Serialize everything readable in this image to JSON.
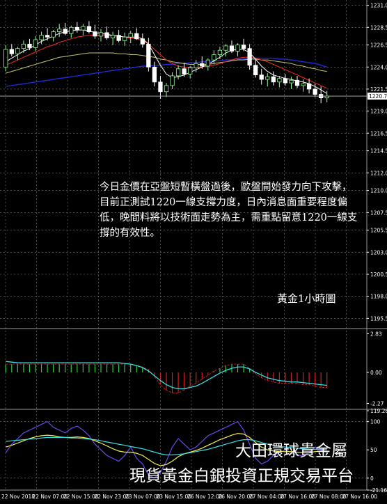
{
  "chart_data": {
    "type": "candlestick",
    "timeframe_label": "黃金1小時圖",
    "x_tick_labels": [
      "22 Nov 2018",
      "22 Nov 07:00",
      "22 Nov 15:00",
      "22 Nov 23:00",
      "23 Nov 07:00",
      "23 Nov 15:00",
      "26 Nov 12:00",
      "26 Nov 20:00",
      "27 Nov 04:00",
      "27 Nov 16:00",
      "27 Nov 08:00",
      "27 Nov 16:00"
    ],
    "price_panel": {
      "y_tick_labels": [
        "1231.0",
        "1228.5",
        "1226.5",
        "1224.0",
        "1221.5",
        "1219.0",
        "1216.5",
        "1214.5",
        "1212.0",
        "1210.0",
        "1207.5",
        "1205.5",
        "1203.0",
        "1200.5",
        "1198.0",
        "1195.5"
      ],
      "current_price": "1220.7",
      "ylim": [
        1194.5,
        1231.6
      ],
      "candles": [
        [
          1224.0,
          1226.5,
          1223.5,
          1226.0
        ],
        [
          1226.0,
          1226.6,
          1225.2,
          1225.5
        ],
        [
          1225.5,
          1226.3,
          1224.8,
          1226.1
        ],
        [
          1226.1,
          1227.0,
          1225.6,
          1226.6
        ],
        [
          1226.6,
          1227.2,
          1225.9,
          1226.2
        ],
        [
          1226.2,
          1227.5,
          1225.8,
          1227.1
        ],
        [
          1227.1,
          1228.0,
          1226.6,
          1227.6
        ],
        [
          1227.6,
          1228.4,
          1227.0,
          1227.4
        ],
        [
          1227.4,
          1228.2,
          1226.9,
          1228.0
        ],
        [
          1228.0,
          1228.9,
          1227.4,
          1228.3
        ],
        [
          1228.3,
          1229.0,
          1227.6,
          1227.8
        ],
        [
          1227.8,
          1228.7,
          1227.3,
          1228.5
        ],
        [
          1228.5,
          1229.1,
          1227.9,
          1228.2
        ],
        [
          1228.2,
          1228.9,
          1227.6,
          1228.6
        ],
        [
          1228.6,
          1229.2,
          1227.8,
          1228.0
        ],
        [
          1228.0,
          1228.8,
          1227.2,
          1227.5
        ],
        [
          1227.5,
          1228.3,
          1226.9,
          1227.9
        ],
        [
          1227.9,
          1228.6,
          1227.1,
          1227.3
        ],
        [
          1227.3,
          1228.0,
          1226.5,
          1227.6
        ],
        [
          1227.6,
          1228.2,
          1226.8,
          1227.0
        ],
        [
          1227.0,
          1227.9,
          1226.4,
          1227.4
        ],
        [
          1227.4,
          1228.1,
          1226.7,
          1227.8
        ],
        [
          1227.8,
          1228.4,
          1227.1,
          1227.2
        ],
        [
          1227.2,
          1227.8,
          1226.2,
          1226.6
        ],
        [
          1226.6,
          1227.3,
          1223.5,
          1224.0
        ],
        [
          1224.0,
          1224.6,
          1221.8,
          1222.3
        ],
        [
          1222.3,
          1223.0,
          1220.4,
          1221.2
        ],
        [
          1221.2,
          1222.2,
          1220.6,
          1221.9
        ],
        [
          1221.9,
          1223.4,
          1221.5,
          1223.0
        ],
        [
          1223.0,
          1224.2,
          1222.6,
          1223.8
        ],
        [
          1223.8,
          1224.5,
          1222.9,
          1223.2
        ],
        [
          1223.2,
          1224.1,
          1222.7,
          1223.9
        ],
        [
          1223.9,
          1224.8,
          1223.4,
          1224.4
        ],
        [
          1224.4,
          1225.2,
          1223.8,
          1224.1
        ],
        [
          1224.1,
          1225.0,
          1223.6,
          1224.8
        ],
        [
          1224.8,
          1225.9,
          1224.3,
          1225.4
        ],
        [
          1225.4,
          1226.3,
          1224.9,
          1225.9
        ],
        [
          1225.9,
          1226.6,
          1225.2,
          1226.4
        ],
        [
          1226.4,
          1227.0,
          1225.6,
          1225.8
        ],
        [
          1225.8,
          1226.7,
          1225.2,
          1226.5
        ],
        [
          1226.5,
          1227.2,
          1225.8,
          1226.1
        ],
        [
          1226.1,
          1226.6,
          1223.7,
          1224.2
        ],
        [
          1224.2,
          1224.9,
          1222.8,
          1223.1
        ],
        [
          1223.1,
          1223.8,
          1222.0,
          1222.6
        ],
        [
          1222.6,
          1223.3,
          1221.8,
          1222.9
        ],
        [
          1222.9,
          1223.5,
          1221.9,
          1222.3
        ],
        [
          1222.3,
          1223.0,
          1221.7,
          1222.7
        ],
        [
          1222.7,
          1223.2,
          1221.9,
          1222.2
        ],
        [
          1222.2,
          1222.9,
          1221.5,
          1222.5
        ],
        [
          1222.5,
          1223.0,
          1221.6,
          1221.9
        ],
        [
          1221.9,
          1222.6,
          1221.2,
          1222.1
        ],
        [
          1222.1,
          1222.7,
          1221.0,
          1221.5
        ],
        [
          1221.5,
          1222.1,
          1220.6,
          1220.9
        ],
        [
          1220.9,
          1221.8,
          1219.9,
          1220.5
        ],
        [
          1220.5,
          1221.3,
          1220.0,
          1220.7
        ]
      ],
      "ma_fast": [
        1224.6,
        1225.0,
        1225.4,
        1225.8,
        1226.1,
        1226.5,
        1226.9,
        1227.2,
        1227.5,
        1227.8,
        1228.0,
        1228.1,
        1228.2,
        1228.2,
        1228.1,
        1227.9,
        1227.8,
        1227.7,
        1227.6,
        1227.5,
        1227.4,
        1227.4,
        1227.4,
        1227.2,
        1226.6,
        1225.4,
        1224.2,
        1223.2,
        1222.8,
        1222.9,
        1223.1,
        1223.4,
        1223.7,
        1224.0,
        1224.3,
        1224.7,
        1225.1,
        1225.6,
        1225.9,
        1226.0,
        1226.0,
        1225.6,
        1224.9,
        1224.1,
        1223.5,
        1223.1,
        1222.9,
        1222.7,
        1222.6,
        1222.4,
        1222.3,
        1222.1,
        1221.8,
        1221.4,
        1221.0
      ],
      "ma_mid": [
        1224.2,
        1224.5,
        1224.8,
        1225.1,
        1225.4,
        1225.7,
        1226.0,
        1226.3,
        1226.5,
        1226.8,
        1227.0,
        1227.2,
        1227.4,
        1227.5,
        1227.6,
        1227.6,
        1227.6,
        1227.6,
        1227.5,
        1227.5,
        1227.4,
        1227.3,
        1227.2,
        1227.0,
        1226.6,
        1226.0,
        1225.4,
        1224.8,
        1224.4,
        1224.1,
        1224.0,
        1223.9,
        1223.9,
        1224.0,
        1224.1,
        1224.2,
        1224.4,
        1224.6,
        1224.8,
        1225.0,
        1225.1,
        1225.1,
        1225.0,
        1224.8,
        1224.6,
        1224.3,
        1224.0,
        1223.7,
        1223.4,
        1223.1,
        1222.8,
        1222.5,
        1222.2,
        1221.9,
        1221.6
      ],
      "ma_slow": [
        1223.3,
        1223.5,
        1223.7,
        1223.9,
        1224.1,
        1224.3,
        1224.5,
        1224.7,
        1224.9,
        1225.1,
        1225.2,
        1225.3,
        1225.4,
        1225.5,
        1225.6,
        1225.6,
        1225.6,
        1225.6,
        1225.6,
        1225.5,
        1225.5,
        1225.4,
        1225.4,
        1225.3,
        1225.2,
        1225.1,
        1224.9,
        1224.8,
        1224.6,
        1224.5,
        1224.4,
        1224.3,
        1224.3,
        1224.3,
        1224.3,
        1224.4,
        1224.5,
        1224.6,
        1224.7,
        1224.8,
        1224.8,
        1224.9,
        1224.9,
        1224.8,
        1224.8,
        1224.7,
        1224.6,
        1224.5,
        1224.4,
        1224.2,
        1224.1,
        1223.9,
        1223.8,
        1223.6,
        1223.5
      ],
      "ma_long": [
        1221.8,
        1221.9,
        1222.0,
        1222.1,
        1222.2,
        1222.3,
        1222.4,
        1222.5,
        1222.6,
        1222.7,
        1222.8,
        1222.9,
        1223.0,
        1223.1,
        1223.2,
        1223.3,
        1223.4,
        1223.5,
        1223.6,
        1223.7,
        1223.8,
        1223.9,
        1224.0,
        1224.1,
        1224.1,
        1224.2,
        1224.2,
        1224.3,
        1224.3,
        1224.4,
        1224.4,
        1224.5,
        1224.5,
        1224.6,
        1224.6,
        1224.7,
        1224.7,
        1224.8,
        1224.8,
        1224.9,
        1224.9,
        1225.0,
        1225.0,
        1225.0,
        1225.0,
        1225.0,
        1224.9,
        1224.9,
        1224.8,
        1224.7,
        1224.6,
        1224.5,
        1224.4,
        1224.2,
        1224.0
      ]
    },
    "macd_panel": {
      "y_tick_labels": [
        "2.83",
        "0.00",
        "-2.27"
      ],
      "ylim": [
        -2.6,
        3.1
      ],
      "histogram": [
        0.6,
        0.6,
        0.6,
        0.6,
        0.6,
        0.6,
        0.6,
        0.6,
        0.6,
        0.6,
        0.6,
        0.6,
        0.6,
        0.6,
        0.6,
        0.6,
        0.6,
        0.6,
        0.6,
        0.6,
        0.6,
        0.6,
        0.5,
        0.4,
        0.2,
        -0.3,
        -0.9,
        -1.3,
        -1.5,
        -1.5,
        -1.3,
        -1.0,
        -0.8,
        -0.5,
        -0.2,
        0.1,
        0.3,
        0.5,
        0.6,
        0.6,
        0.6,
        0.3,
        -0.1,
        -0.4,
        -0.6,
        -0.7,
        -0.8,
        -0.8,
        -0.8,
        -0.8,
        -0.9,
        -0.9,
        -1.0,
        -1.1,
        -1.1
      ],
      "signal": [
        0.8,
        0.75,
        0.7,
        0.7,
        0.7,
        0.7,
        0.7,
        0.7,
        0.7,
        0.7,
        0.7,
        0.7,
        0.7,
        0.7,
        0.7,
        0.7,
        0.7,
        0.7,
        0.7,
        0.7,
        0.65,
        0.6,
        0.5,
        0.35,
        0.1,
        -0.25,
        -0.6,
        -0.9,
        -1.1,
        -1.2,
        -1.2,
        -1.1,
        -1.0,
        -0.8,
        -0.55,
        -0.3,
        -0.05,
        0.15,
        0.3,
        0.4,
        0.4,
        0.25,
        0.0,
        -0.2,
        -0.4,
        -0.5,
        -0.6,
        -0.65,
        -0.7,
        -0.7,
        -0.75,
        -0.8,
        -0.85,
        -0.9,
        -0.95
      ]
    },
    "oscillator_panel": {
      "y_tick_labels": [
        "119.267",
        "100",
        "50",
        "0",
        "-21.166"
      ],
      "ylim": [
        -21.166,
        119.267
      ],
      "series": [
        [
          45,
          60,
          70,
          80,
          85,
          90,
          95,
          100,
          90,
          85,
          80,
          88,
          92,
          85,
          75,
          60,
          50,
          40,
          35,
          30,
          40,
          55,
          35,
          25,
          5,
          0,
          10,
          30,
          55,
          70,
          60,
          50,
          55,
          65,
          75,
          80,
          85,
          90,
          95,
          100,
          85,
          60,
          35,
          25,
          30,
          40,
          45,
          50,
          45,
          40,
          40,
          45,
          55,
          50,
          45
        ],
        [
          55,
          58,
          62,
          66,
          70,
          73,
          75,
          76,
          75,
          73,
          72,
          72,
          73,
          72,
          70,
          66,
          62,
          57,
          52,
          48,
          46,
          46,
          44,
          40,
          33,
          26,
          22,
          24,
          30,
          38,
          43,
          46,
          49,
          53,
          58,
          63,
          68,
          72,
          76,
          79,
          78,
          72,
          63,
          55,
          50,
          48,
          47,
          47,
          47,
          46,
          45,
          45,
          47,
          48,
          48
        ],
        [
          65,
          66,
          67,
          68,
          69,
          70,
          71,
          72,
          72,
          72,
          72,
          71,
          71,
          70,
          69,
          68,
          66,
          64,
          62,
          60,
          58,
          56,
          54,
          52,
          49,
          46,
          43,
          41,
          41,
          42,
          43,
          45,
          47,
          49,
          51,
          54,
          57,
          60,
          63,
          66,
          68,
          68,
          66,
          63,
          60,
          58,
          56,
          55,
          54,
          53,
          52,
          51,
          51,
          51,
          51
        ]
      ]
    }
  },
  "annotations": {
    "commentary": "今日金價在亞盤短暫橫盤過後，歐盤開始發力向下攻擊，目前正測試1220一線支撐力度，日內消息面重要程度偏低，晚間料將以技術面走勢為主，需重點留意1220一線支撐的有效性。",
    "chart_title": "黃金1小時圖",
    "brand_line1": "大田環球貴金屬",
    "brand_line2": "現貨黃金白銀投資正規交易平台"
  },
  "colors": {
    "background": "#000000",
    "grid": "#7f7f7f",
    "axis_text": "#ffffff",
    "candle_up": "#98fb98",
    "candle_down": "#ffffff",
    "ma_fast": "#ffffff",
    "ma_mid": "#ff2a2a",
    "ma_slow": "#c8c46a",
    "ma_long": "#1e2bd6",
    "macd_hist_pos": "#2ecc40",
    "macd_hist_neg": "#d42020",
    "macd_signal": "#33e0e8",
    "macd_signal2": "#d42020",
    "osc_1": "#6a48e8",
    "osc_2": "#f5f04a",
    "osc_3": "#33e0e8"
  }
}
